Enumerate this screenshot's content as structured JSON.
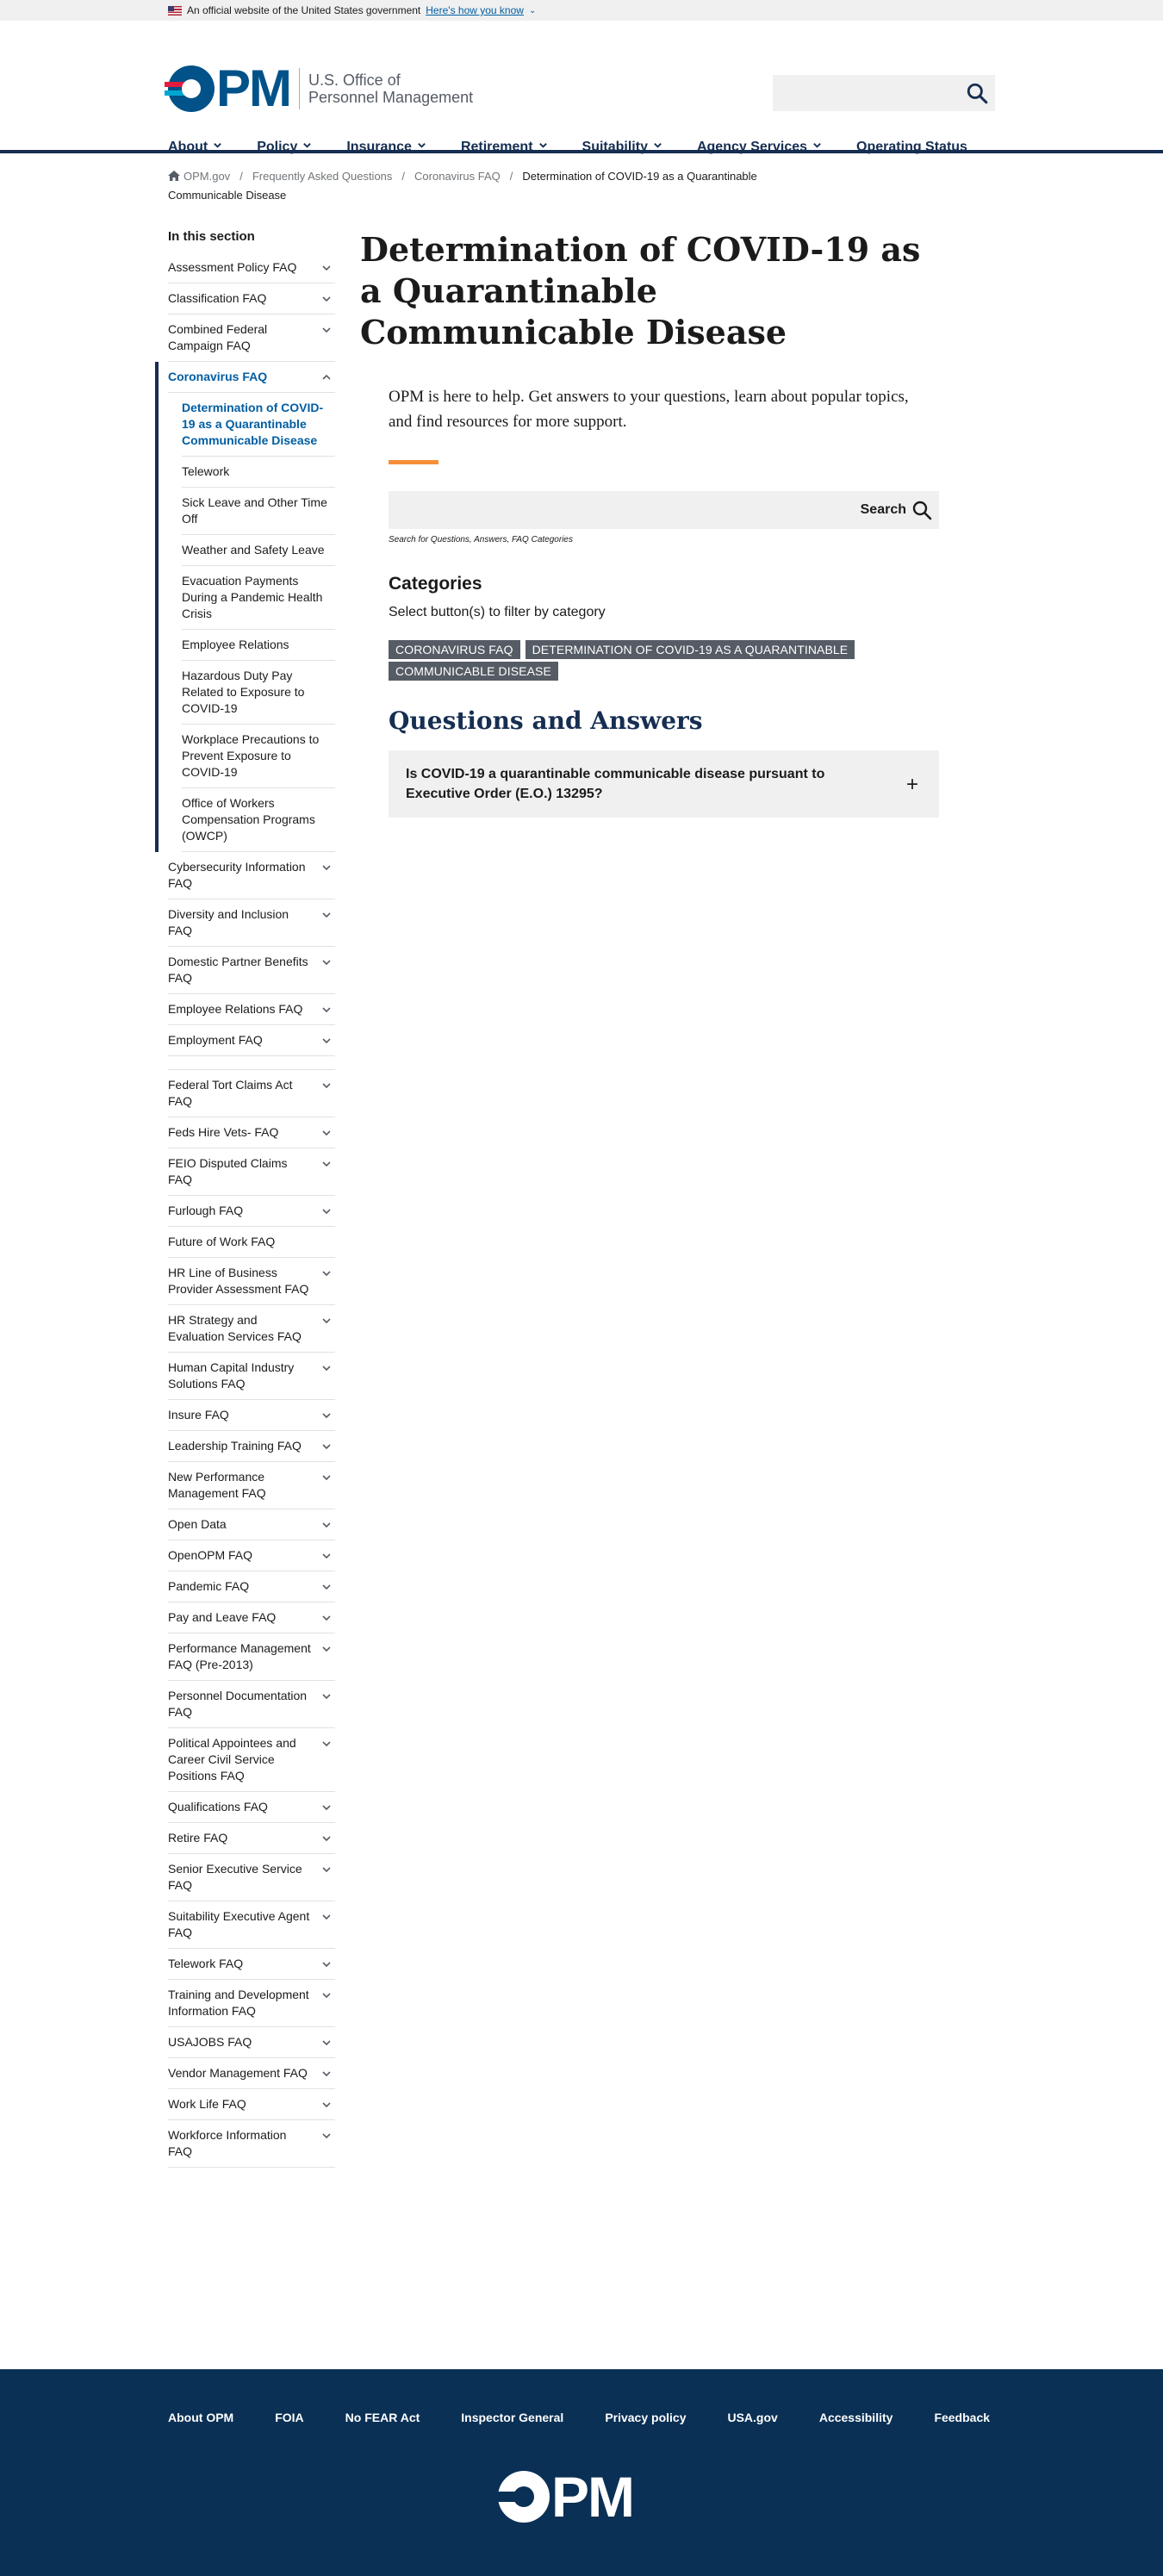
{
  "gov_banner": {
    "text": "An official website of the United States government",
    "link": "Here's how you know"
  },
  "header": {
    "logo_letters": "PM",
    "logo_line1": "U.S. Office of",
    "logo_line2": "Personnel Management"
  },
  "nav": {
    "items": [
      {
        "label": "About",
        "has_menu": true
      },
      {
        "label": "Policy",
        "has_menu": true
      },
      {
        "label": "Insurance",
        "has_menu": true
      },
      {
        "label": "Retirement",
        "has_menu": true
      },
      {
        "label": "Suitability",
        "has_menu": true
      },
      {
        "label": "Agency Services",
        "has_menu": true
      },
      {
        "label": "Operating Status",
        "has_menu": false
      }
    ]
  },
  "breadcrumb": {
    "items": [
      "OPM.gov",
      "Frequently Asked Questions",
      "Coronavirus FAQ"
    ],
    "current": "Determination of COVID-19 as a Quarantinable Communicable Disease"
  },
  "sidebar": {
    "heading": "In this section",
    "before": [
      "Assessment Policy FAQ",
      "Classification FAQ",
      "Combined Federal Campaign FAQ"
    ],
    "active_parent": "Coronavirus FAQ",
    "sub_items": [
      "Determination of COVID-19 as a Quarantinable Communicable Disease",
      "Telework",
      "Sick Leave and Other Time Off",
      "Weather and Safety Leave",
      "Evacuation Payments During a Pandemic Health Crisis",
      "Employee Relations",
      "Hazardous Duty Pay Related to Exposure to COVID-19",
      "Workplace Precautions to Prevent Exposure to COVID-19",
      "Office of Workers Compensation Programs (OWCP)"
    ],
    "after_a": [
      {
        "label": "Cybersecurity Information FAQ",
        "toggle": true
      },
      {
        "label": "Diversity and Inclusion FAQ",
        "toggle": true
      },
      {
        "label": "Domestic Partner Benefits FAQ",
        "toggle": true
      },
      {
        "label": "Employee Relations FAQ",
        "toggle": true
      },
      {
        "label": "Employment FAQ",
        "toggle": true
      }
    ],
    "after_b": [
      {
        "label": "Federal Tort Claims Act FAQ",
        "toggle": true
      },
      {
        "label": "Feds Hire Vets- FAQ",
        "toggle": true
      },
      {
        "label": "FEIO Disputed Claims FAQ",
        "toggle": true
      },
      {
        "label": "Furlough FAQ",
        "toggle": true
      },
      {
        "label": "Future of Work FAQ",
        "toggle": false
      },
      {
        "label": "HR Line of Business Provider Assessment FAQ",
        "toggle": true
      },
      {
        "label": "HR Strategy and Evaluation Services FAQ",
        "toggle": true
      },
      {
        "label": "Human Capital Industry Solutions FAQ",
        "toggle": true
      },
      {
        "label": "Insure FAQ",
        "toggle": true
      },
      {
        "label": "Leadership Training FAQ",
        "toggle": true
      },
      {
        "label": "New Performance Management FAQ",
        "toggle": true
      },
      {
        "label": "Open Data",
        "toggle": true
      },
      {
        "label": "OpenOPM FAQ",
        "toggle": true
      },
      {
        "label": "Pandemic FAQ",
        "toggle": true
      },
      {
        "label": "Pay and Leave FAQ",
        "toggle": true
      },
      {
        "label": "Performance Management FAQ (Pre-2013)",
        "toggle": true
      },
      {
        "label": "Personnel Documentation FAQ",
        "toggle": true
      },
      {
        "label": "Political Appointees and Career Civil Service Positions FAQ",
        "toggle": true
      },
      {
        "label": "Qualifications FAQ",
        "toggle": true
      },
      {
        "label": "Retire FAQ",
        "toggle": true
      },
      {
        "label": "Senior Executive Service FAQ",
        "toggle": true
      },
      {
        "label": "Suitability Executive Agent FAQ",
        "toggle": true
      },
      {
        "label": "Telework FAQ",
        "toggle": true
      },
      {
        "label": "Training and Development Information FAQ",
        "toggle": true
      },
      {
        "label": "USAJOBS FAQ",
        "toggle": true
      },
      {
        "label": "Vendor Management FAQ",
        "toggle": true
      },
      {
        "label": "Work Life FAQ",
        "toggle": true
      },
      {
        "label": "Workforce Information FAQ",
        "toggle": true
      }
    ]
  },
  "main": {
    "title": "Determination of COVID-19 as a Quarantinable Communicable Disease",
    "intro": "OPM is here to help. Get answers to your questions, learn about popular topics, and find resources for more support.",
    "search_label": "Search",
    "search_hint": "Search for Questions, Answers, FAQ Categories",
    "categories_heading": "Categories",
    "categories_sub": "Select button(s) to filter by category",
    "chips": [
      "CORONAVIRUS FAQ",
      "DETERMINATION OF COVID-19 AS A QUARANTINABLE COMMUNICABLE DISEASE"
    ],
    "qa_heading": "Questions and Answers",
    "questions": [
      "Is COVID-19 a quarantinable communicable disease pursuant to Executive Order (E.O.) 13295?"
    ]
  },
  "footer": {
    "links": [
      "About OPM",
      "FOIA",
      "No FEAR Act",
      "Inspector General",
      "Privacy policy",
      "USA.gov",
      "Accessibility",
      "Feedback"
    ],
    "logo_letters": "PM"
  },
  "colors": {
    "navy": "#162e51",
    "link_blue": "#005ea2",
    "accent_orange": "#f78e3a",
    "footer_bg": "#0a3055",
    "chip_bg": "#565c65"
  }
}
